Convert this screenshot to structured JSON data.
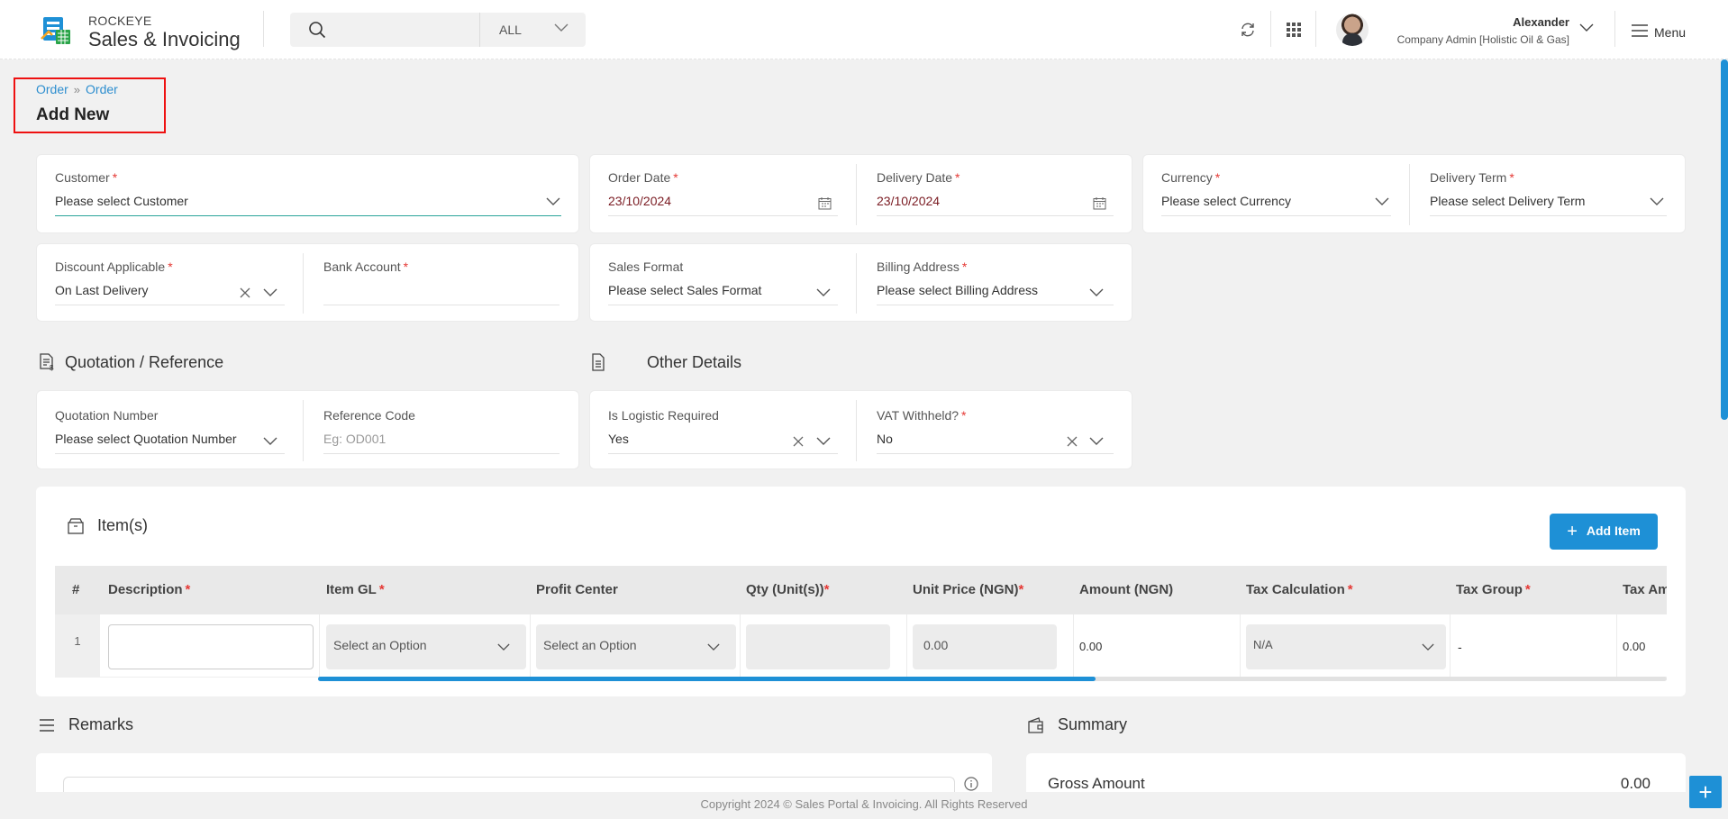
{
  "app": {
    "brand_top": "ROCKEYE",
    "brand_main": "Sales & Invoicing"
  },
  "header": {
    "search_placeholder": "",
    "search_filter": "ALL",
    "user_name": "Alexander",
    "user_role": "Company Admin [Holistic Oil & Gas]",
    "menu_label": "Menu"
  },
  "breadcrumb": {
    "item1": "Order",
    "item2": "Order",
    "title": "Add New"
  },
  "form": {
    "customer": {
      "label": "Customer",
      "value": "Please select Customer"
    },
    "order_date": {
      "label": "Order Date",
      "value": "23/10/2024"
    },
    "delivery_date": {
      "label": "Delivery Date",
      "value": "23/10/2024"
    },
    "currency": {
      "label": "Currency",
      "value": "Please select Currency"
    },
    "delivery_term": {
      "label": "Delivery Term",
      "value": "Please select Delivery Term"
    },
    "discount_applicable": {
      "label": "Discount Applicable",
      "value": "On Last Delivery"
    },
    "bank_account": {
      "label": "Bank Account",
      "value": ""
    },
    "sales_format": {
      "label": "Sales Format",
      "value": "Please select Sales Format"
    },
    "billing_address": {
      "label": "Billing Address",
      "value": "Please select Billing Address"
    }
  },
  "sections": {
    "quotation_title": "Quotation / Reference",
    "other_title": "Other Details",
    "items_title": "Item(s)",
    "remarks_title": "Remarks",
    "summary_title": "Summary"
  },
  "quotation": {
    "number": {
      "label": "Quotation Number",
      "value": "Please select Quotation Number"
    },
    "reference": {
      "label": "Reference Code",
      "placeholder": "Eg: OD001"
    }
  },
  "other": {
    "logistic": {
      "label": "Is Logistic Required",
      "value": "Yes"
    },
    "vat": {
      "label": "VAT Withheld?",
      "value": "No"
    }
  },
  "items": {
    "add_label": "Add Item",
    "headers": {
      "num": "#",
      "description": "Description",
      "item_gl": "Item GL",
      "profit_center": "Profit Center",
      "qty": "Qty (Unit(s))",
      "unit_price": "Unit Price (NGN)",
      "amount": "Amount (NGN)",
      "tax_calc": "Tax Calculation",
      "tax_group": "Tax Group",
      "tax_amount": "Tax Am"
    },
    "row": {
      "num": "1",
      "item_gl": "Select an Option",
      "profit_center": "Select an Option",
      "unit_price": "0.00",
      "amount": "0.00",
      "tax_calc": "N/A",
      "tax_group": "-",
      "tax_amount": "0.00"
    }
  },
  "summary": {
    "gross_label": "Gross Amount",
    "gross_value": "0.00"
  },
  "footer": {
    "text": "Copyright 2024 © Sales Portal & Invoicing. All Rights Reserved"
  },
  "colors": {
    "accent": "#1e90d6",
    "required": "#e53935",
    "highlight": "#e11111",
    "active_line": "#2aa49a"
  }
}
